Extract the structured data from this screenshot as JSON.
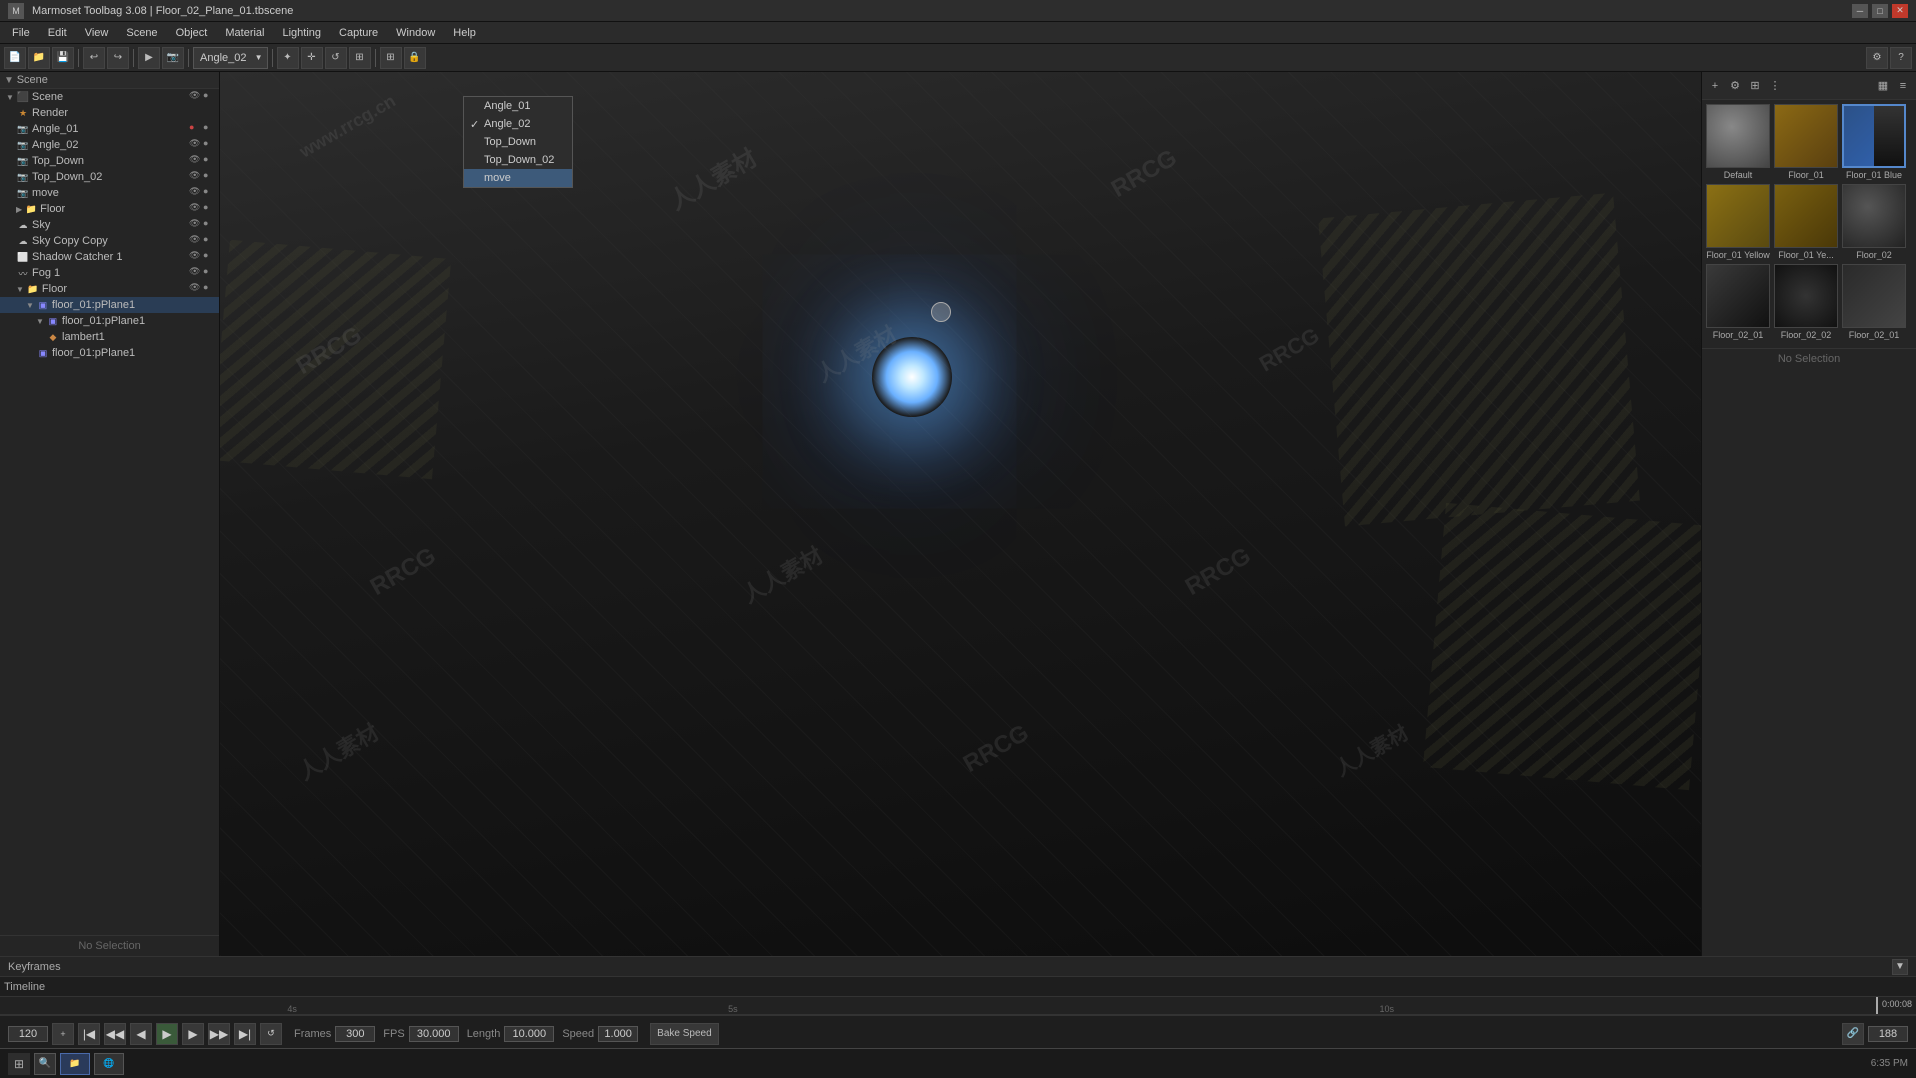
{
  "titlebar": {
    "title": "Marmoset Toolbag 3.08 | Floor_02_Plane_01.tbscene",
    "min_label": "─",
    "max_label": "□",
    "close_label": "✕"
  },
  "menubar": {
    "items": [
      "File",
      "Edit",
      "View",
      "Scene",
      "Object",
      "Material",
      "Lighting",
      "Capture",
      "Window",
      "Help"
    ]
  },
  "viewport_toolbar": {
    "camera_label": "Angle_02",
    "extra_items": [
      "Angle_01"
    ]
  },
  "camera_dropdown": {
    "options": [
      {
        "label": "Angle_01",
        "checked": false
      },
      {
        "label": "Angle_02",
        "checked": true
      },
      {
        "label": "Top_Down",
        "checked": false
      },
      {
        "label": "Top_Down_02",
        "checked": false
      },
      {
        "label": "move",
        "checked": false,
        "hovered": true
      }
    ]
  },
  "left_panel": {
    "scene_label": "Scene",
    "items": [
      {
        "label": "Scene",
        "indent": 0,
        "type": "folder",
        "expanded": true
      },
      {
        "label": "Render",
        "indent": 1,
        "type": "item"
      },
      {
        "label": "Angle_01",
        "indent": 1,
        "type": "camera"
      },
      {
        "label": "Angle_02",
        "indent": 1,
        "type": "camera"
      },
      {
        "label": "Top_Down",
        "indent": 1,
        "type": "camera"
      },
      {
        "label": "Top_Down_02",
        "indent": 1,
        "type": "camera"
      },
      {
        "label": "move",
        "indent": 1,
        "type": "camera"
      },
      {
        "label": "Floor",
        "indent": 1,
        "type": "folder"
      },
      {
        "label": "Sky",
        "indent": 1,
        "type": "item"
      },
      {
        "label": "Sky Copy Copy",
        "indent": 1,
        "type": "item"
      },
      {
        "label": "Shadow Catcher 1",
        "indent": 1,
        "type": "item"
      },
      {
        "label": "Fog 1",
        "indent": 1,
        "type": "item"
      },
      {
        "label": "Floor",
        "indent": 1,
        "type": "folder",
        "expanded": true
      },
      {
        "label": "floor_01:pPlane1",
        "indent": 2,
        "type": "mesh"
      },
      {
        "label": "floor_01:pPlane1",
        "indent": 3,
        "type": "mesh"
      },
      {
        "label": "lambert1",
        "indent": 4,
        "type": "material"
      },
      {
        "label": "floor_01:pPlane1",
        "indent": 3,
        "type": "mesh"
      }
    ],
    "no_selection": "No Selection"
  },
  "right_panel": {
    "no_selection": "No Selection",
    "materials": [
      {
        "label": "Default",
        "class": "mat-default"
      },
      {
        "label": "Floor_01",
        "class": "mat-floor01"
      },
      {
        "label": "Floor_01 Blue",
        "class": "mat-floor01blue",
        "selected": true
      },
      {
        "label": "Floor_01 Yellow",
        "class": "mat-floor01yellow"
      },
      {
        "label": "Floor_01 Ye...",
        "class": "mat-floor01ye"
      },
      {
        "label": "Floor_02",
        "class": "mat-floor02"
      },
      {
        "label": "Floor_02_01",
        "class": "mat-floor02_01"
      },
      {
        "label": "Floor_02_02",
        "class": "mat-floor02_02"
      },
      {
        "label": "Floor_02_01",
        "class": "mat-floor02_01b"
      }
    ]
  },
  "timeline": {
    "keyframes_label": "Keyframes",
    "timeline_label": "Timeline",
    "marks": [
      "4s",
      "5s",
      "10s"
    ],
    "frame_current": "120",
    "frames_label": "Frames",
    "frames_value": "300",
    "fps_label": "FPS",
    "fps_value": "30.000",
    "length_label": "Length",
    "length_value": "10.000",
    "speed_label": "Speed",
    "speed_value": "1.000",
    "bake_speed_label": "Bake Speed",
    "timecode": "0:00:08",
    "playback_value": "188"
  },
  "watermarks": [
    "RRCG",
    "人人素材",
    "www.rrcg.cn"
  ],
  "statusbar": {
    "time": "6:35 PM",
    "items": []
  }
}
